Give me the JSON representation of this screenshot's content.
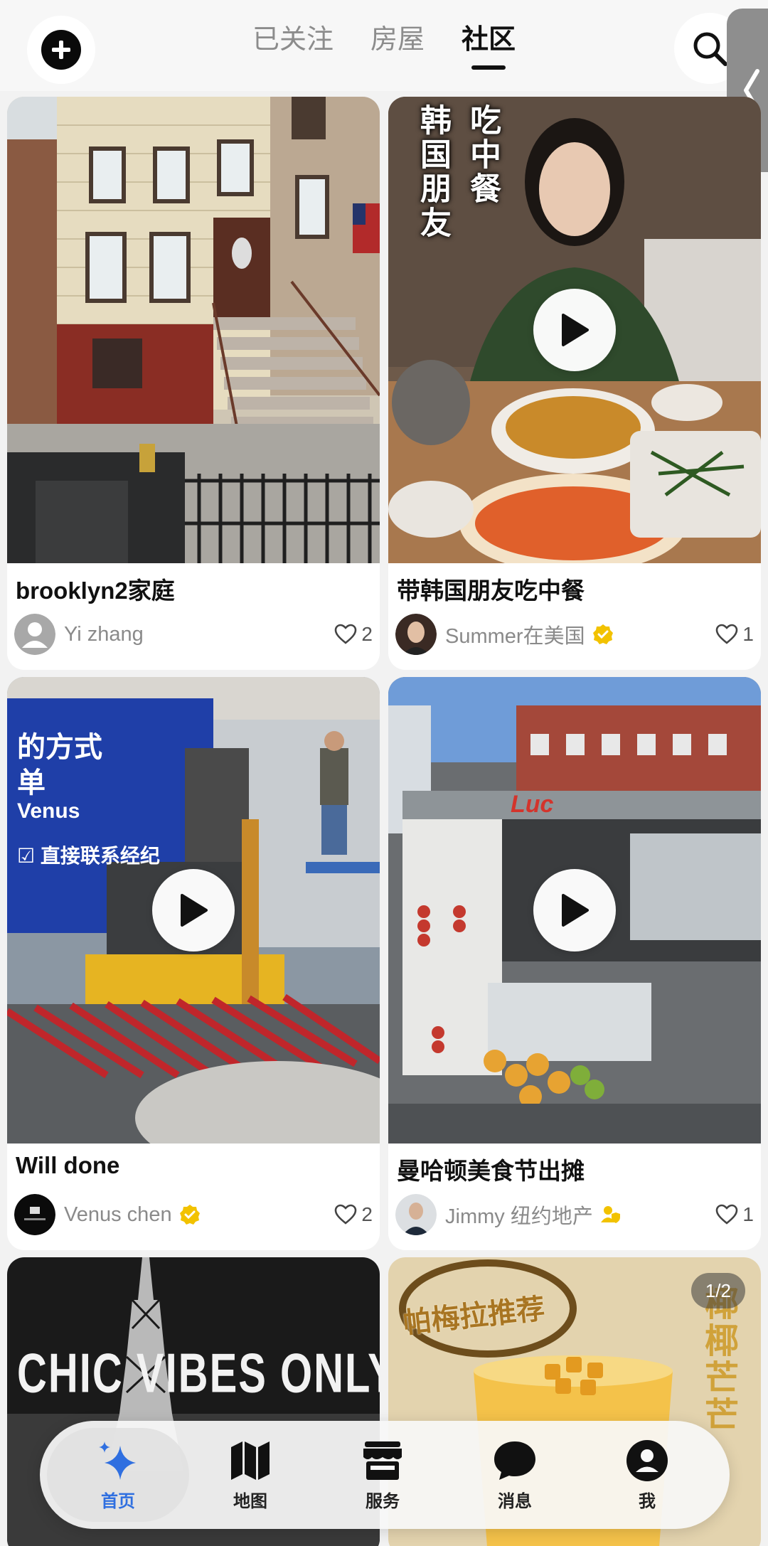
{
  "header": {
    "tabs": [
      {
        "label": "已关注",
        "active": false
      },
      {
        "label": "房屋",
        "active": false
      },
      {
        "label": "社区",
        "active": true
      }
    ],
    "add_icon": "plus-icon",
    "search_icon": "search-icon",
    "side_handle_icon": "chevron-left-icon"
  },
  "posts": [
    {
      "title": "brooklyn2家庭",
      "author": "Yi zhang",
      "verified": false,
      "likes": "2",
      "is_video": false
    },
    {
      "title": "带韩国朋友吃中餐",
      "author": "Summer在美国",
      "verified": true,
      "likes": "1",
      "is_video": true,
      "overlay_left": "韩国朋友",
      "overlay_right": "吃中餐"
    },
    {
      "title": "Will done",
      "author": "Venus chen",
      "verified": true,
      "likes": "2",
      "is_video": true,
      "sign_lines": [
        "的方式",
        "单",
        "Venus",
        "☑ 直接联系经纪"
      ]
    },
    {
      "title": "曼哈顿美食节出摊",
      "author": "Jimmy 纽约地产",
      "verified": false,
      "agent_badge": true,
      "likes": "1",
      "is_video": true,
      "cart_sign": "Luc"
    },
    {
      "overlay_text": "CHIC VIBES ONLY"
    },
    {
      "overlay_badge": "帕梅拉推荐",
      "overlay_side": "椰椰芒芒",
      "counter": "1/2"
    }
  ],
  "bottom_nav": [
    {
      "label": "首页",
      "icon": "sparkle-icon",
      "active": true
    },
    {
      "label": "地图",
      "icon": "map-icon",
      "active": false
    },
    {
      "label": "服务",
      "icon": "store-icon",
      "active": false
    },
    {
      "label": "消息",
      "icon": "chat-bubble-icon",
      "active": false
    },
    {
      "label": "我",
      "icon": "user-icon",
      "active": false
    }
  ],
  "colors": {
    "accent": "#2f6fe0",
    "verified": "#f2c200",
    "background": "#f2f2f2"
  }
}
